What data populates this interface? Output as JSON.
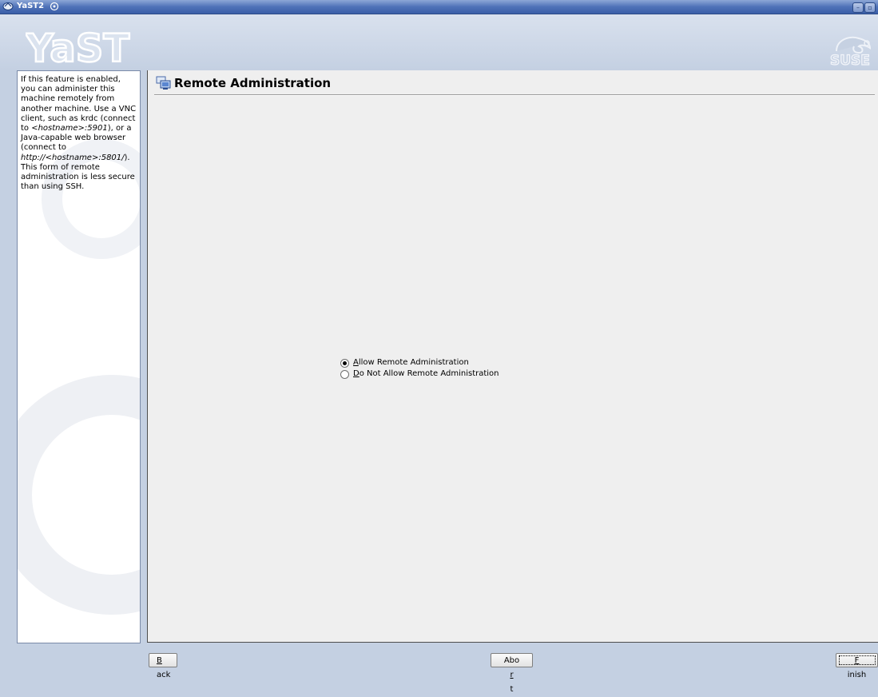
{
  "window": {
    "title": "YaST2",
    "minimize_glyph": "–",
    "maximize_glyph": "▫"
  },
  "header": {
    "yast_logo_text": "YaST",
    "suse_logo_text": "SUSE"
  },
  "help": {
    "p1": "If this feature is enabled, you can administer this machine remotely from another machine. Use a VNC client, such as krdc (connect to ",
    "p2": "<hostname>:5901",
    "p3": "), or a Java-capable web browser (connect to ",
    "p4": "http://<hostname>:5801/",
    "p5": "). This form of remote administration is less secure than using SSH."
  },
  "page": {
    "title": "Remote Administration",
    "icon": "remote-admin-icon"
  },
  "options": [
    {
      "mnemonic": "A",
      "rest": "llow Remote Administration",
      "checked": true
    },
    {
      "mnemonic": "D",
      "rest": "o Not Allow Remote Administration",
      "checked": false
    }
  ],
  "buttons": {
    "back": {
      "mnemonic": "B",
      "rest": "ack"
    },
    "abort": {
      "pre": "Abo",
      "mnemonic": "r",
      "post": "t"
    },
    "finish": {
      "mnemonic": "F",
      "rest": "inish"
    }
  },
  "colors": {
    "titlebar": "#4f72b8",
    "background": "#c4d0e2",
    "content": "#efefef"
  }
}
